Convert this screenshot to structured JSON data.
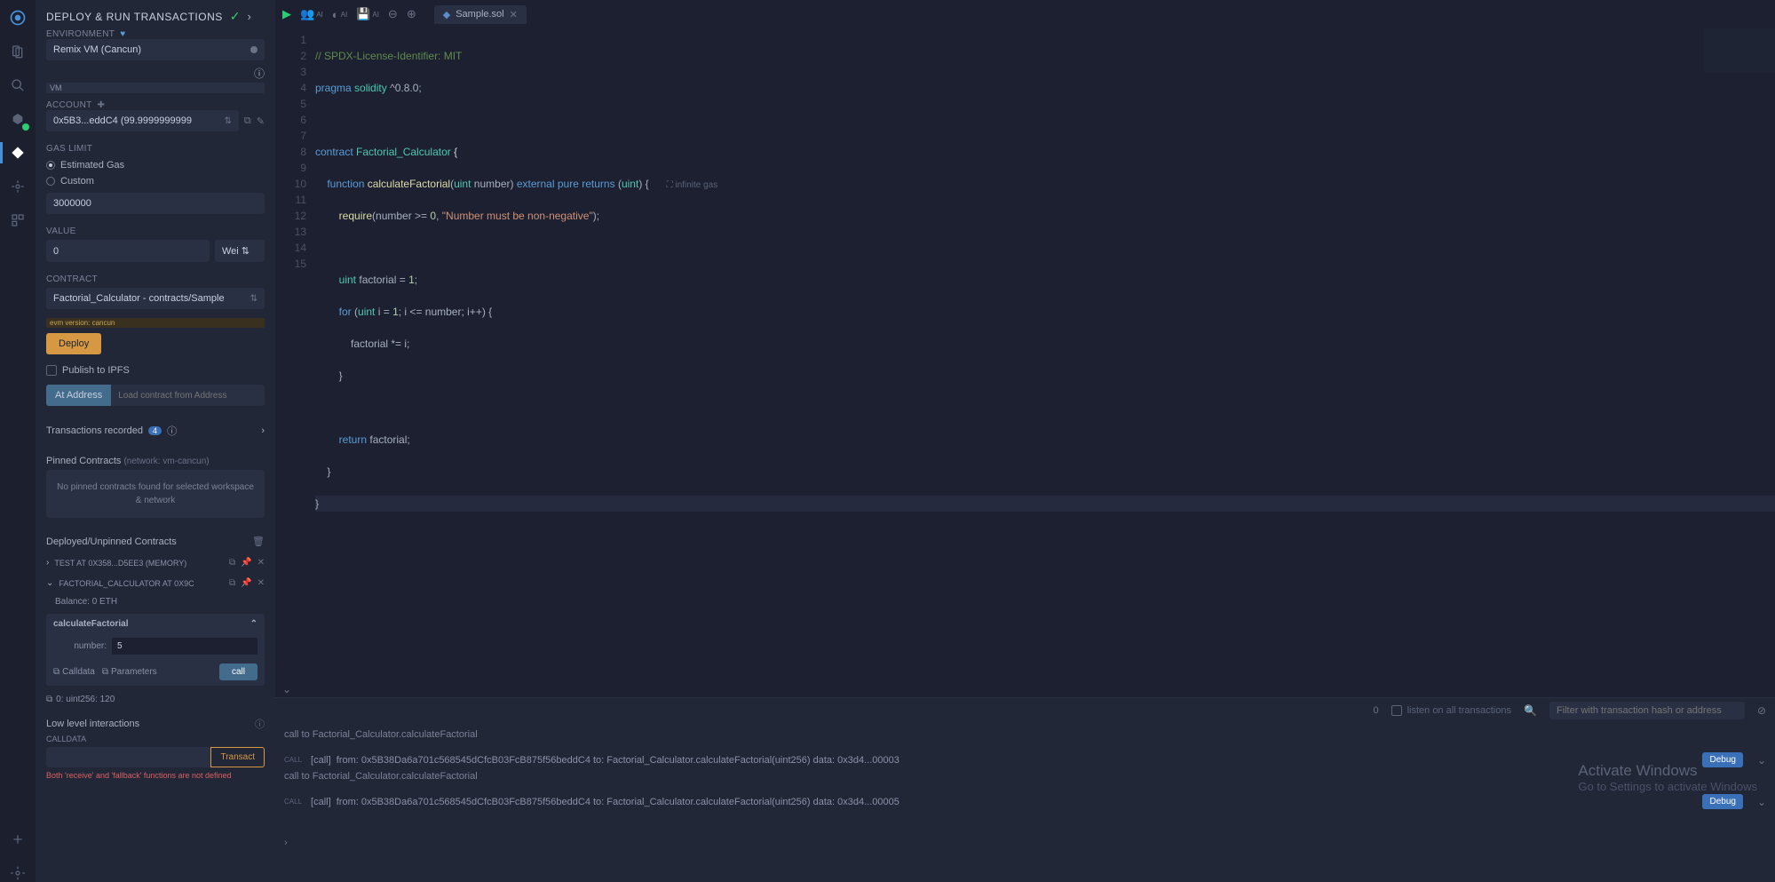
{
  "panel": {
    "title": "DEPLOY & RUN TRANSACTIONS",
    "env_label": "ENVIRONMENT",
    "env_value": "Remix VM (Cancun)",
    "vm_badge": "VM",
    "account_label": "ACCOUNT",
    "account_value": "0x5B3...eddC4 (99.9999999999",
    "gas_label": "GAS LIMIT",
    "gas_estimated": "Estimated Gas",
    "gas_custom": "Custom",
    "gas_value": "3000000",
    "value_label": "VALUE",
    "value_value": "0",
    "value_unit": "Wei",
    "contract_label": "CONTRACT",
    "contract_value": "Factorial_Calculator - contracts/Sample",
    "evm_tag": "evm version: cancun",
    "deploy_btn": "Deploy",
    "publish_ipfs": "Publish to IPFS",
    "ataddress_btn": "At Address",
    "ataddress_ph": "Load contract from Address",
    "tx_recorded": "Transactions recorded",
    "tx_count": "4",
    "pinned_header": "Pinned Contracts",
    "pinned_sub": "(network: vm-cancun)",
    "pinned_empty": "No pinned contracts found for selected workspace & network",
    "deployed_header": "Deployed/Unpinned Contracts",
    "contract1": "TEST AT 0X358...D5EE3 (MEMORY)",
    "contract2": "FACTORIAL_CALCULATOR AT 0X9C",
    "balance": "Balance: 0 ETH",
    "func_name": "calculateFactorial",
    "func_param": "number:",
    "func_param_val": "5",
    "calldata_lbl": "Calldata",
    "params_lbl": "Parameters",
    "call_btn": "call",
    "result": "0: uint256: 120",
    "lowlevel_title": "Low level interactions",
    "calldata_header": "CALLDATA",
    "transact_btn": "Transact",
    "warn": "Both 'receive' and 'fallback' functions are not defined"
  },
  "tab": {
    "name": "Sample.sol"
  },
  "code": {
    "l1": "// SPDX-License-Identifier: MIT",
    "l2_a": "pragma",
    "l2_b": "solidity",
    "l2_c": "^0.8.0;",
    "l4_a": "contract",
    "l4_b": "Factorial_Calculator",
    "l4_c": "{",
    "l5_a": "function",
    "l5_b": "calculateFactorial",
    "l5_c": "uint",
    "l5_d": "number",
    "l5_e": "external",
    "l5_f": "pure",
    "l5_g": "returns",
    "l5_h": "uint",
    "l5_gas": "infinite gas",
    "l6_a": "require",
    "l6_b": "number >= ",
    "l6_c": "0",
    "l6_d": "\"Number must be non-negative\"",
    "l8_a": "uint",
    "l8_b": "factorial = ",
    "l8_c": "1",
    "l9_a": "for",
    "l9_b": "uint",
    "l9_c": "i = ",
    "l9_d": "1",
    "l9_e": "; i <= number; i++) {",
    "l10": "factorial *= i;",
    "l13_a": "return",
    "l13_b": "factorial;"
  },
  "terminal": {
    "filter_ph": "Filter with transaction hash or address",
    "listen_lbl": "listen on all transactions",
    "zero": "0",
    "l1": "call to Factorial_Calculator.calculateFactorial",
    "l2": "[call]  from: 0x5B38Da6a701c568545dCfcB03FcB875f56beddC4 to: Factorial_Calculator.calculateFactorial(uint256) data: 0x3d4...00003",
    "l3": "call to Factorial_Calculator.calculateFactorial",
    "l4": "[call]  from: 0x5B38Da6a701c568545dCfcB03FcB875f56beddC4 to: Factorial_Calculator.calculateFactorial(uint256) data: 0x3d4...00005",
    "debug_btn": "Debug"
  },
  "watermark": {
    "big": "Activate Windows",
    "small": "Go to Settings to activate Windows"
  }
}
